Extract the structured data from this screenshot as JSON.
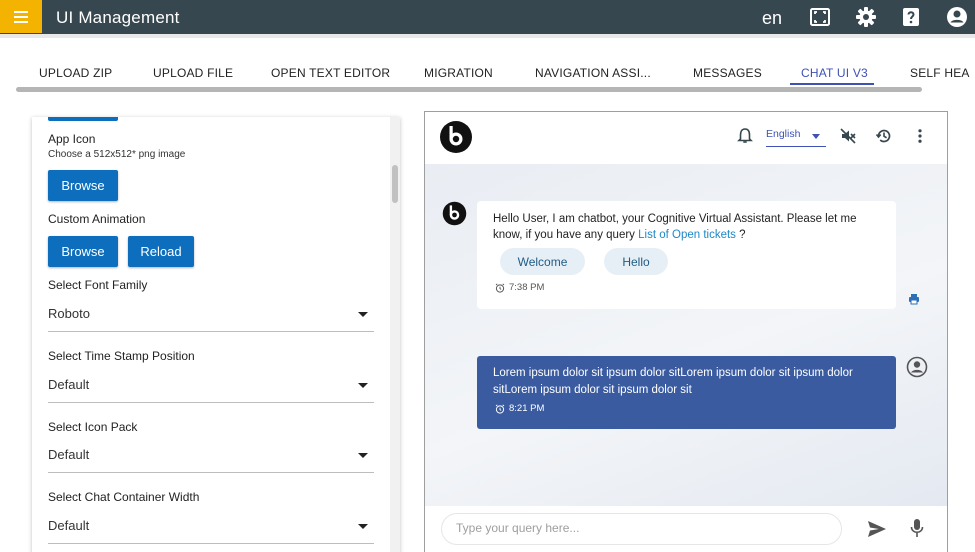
{
  "header": {
    "title": "UI Management",
    "language": "en",
    "icons": [
      "menu-icon",
      "fullscreen-icon",
      "settings-icon",
      "help-icon",
      "account-icon"
    ],
    "accent": "#f5b301",
    "bar_color": "#37474f"
  },
  "tabs": [
    {
      "label": "UPLOAD ZIP"
    },
    {
      "label": "UPLOAD FILE"
    },
    {
      "label": "OPEN TEXT EDITOR"
    },
    {
      "label": "MIGRATION"
    },
    {
      "label": "NAVIGATION ASSI..."
    },
    {
      "label": "MESSAGES"
    },
    {
      "label": "CHAT UI V3",
      "active": true
    },
    {
      "label": "SELF HEA"
    }
  ],
  "config": {
    "app_icon": {
      "label": "App Icon",
      "hint": "Choose a 512x512* png image",
      "browse_label": "Browse"
    },
    "custom_animation": {
      "label": "Custom Animation",
      "browse_label": "Browse",
      "reload_label": "Reload"
    },
    "font_family": {
      "label": "Select Font Family",
      "value": "Roboto"
    },
    "timestamp_position": {
      "label": "Select Time Stamp Position",
      "value": "Default"
    },
    "icon_pack": {
      "label": "Select Icon Pack",
      "value": "Default"
    },
    "chat_container_width": {
      "label": "Select Chat Container Width",
      "value": "Default"
    },
    "button_color": "#0d6ebd"
  },
  "chat": {
    "language": "English",
    "header_icons": [
      "bell-icon",
      "mute-icon",
      "history-icon",
      "more-vert-icon"
    ],
    "bot_message": {
      "text": "Hello User, I am chatbot, your Cognitive Virtual Assistant. Please let me know, if you have any query ",
      "link": "List of Open tickets",
      "suffix": " ?",
      "chips": [
        "Welcome",
        "Hello"
      ],
      "time": "7:38 PM"
    },
    "user_message": {
      "text": "Lorem ipsum dolor sit ipsum dolor sitLorem ipsum dolor sit ipsum dolor sitLorem ipsum dolor sit ipsum dolor sit",
      "time": "8:21 PM",
      "bubble_color": "#3a5ba0"
    },
    "input_placeholder": "Type your query here..."
  }
}
